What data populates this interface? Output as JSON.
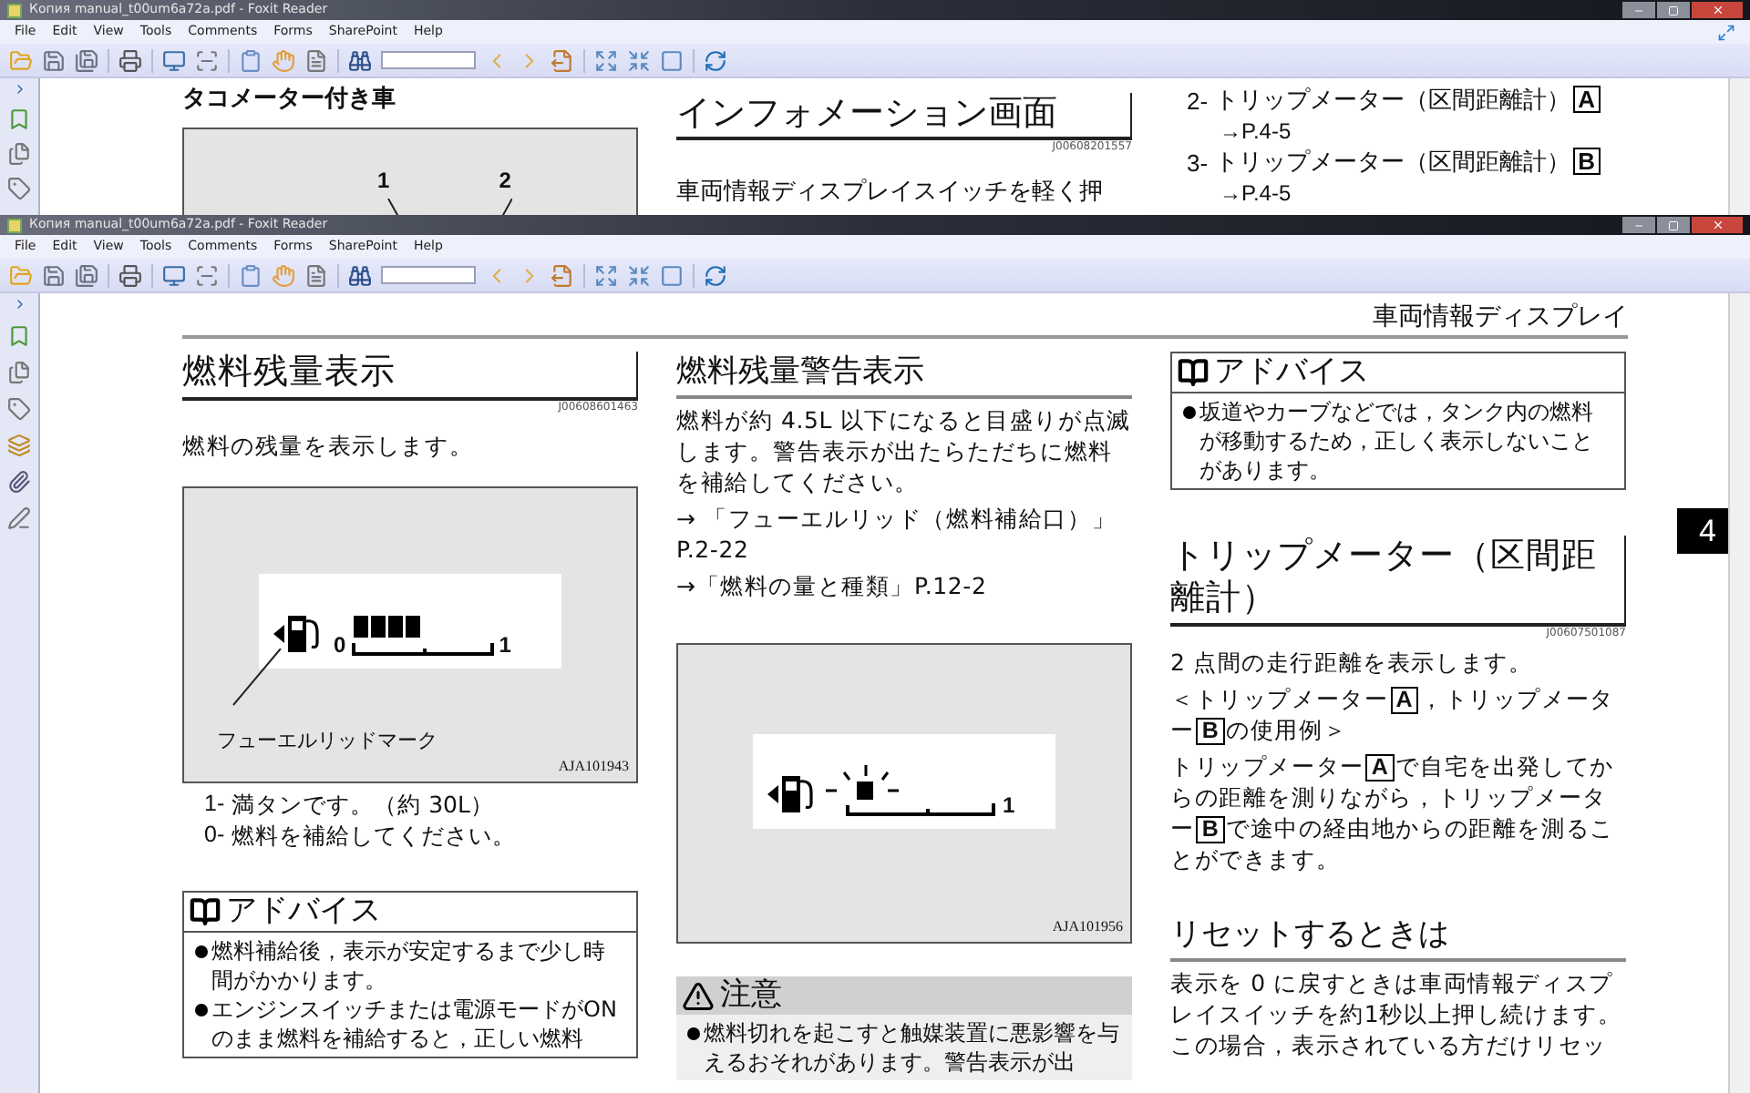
{
  "top_window": {
    "title": "Копия manual_t00um6a72a.pdf - Foxit Reader",
    "menu": [
      "File",
      "Edit",
      "View",
      "Tools",
      "Comments",
      "Forms",
      "SharePoint",
      "Help"
    ],
    "page": {
      "left_heading": "タコメーター付き車",
      "figure_labels": [
        "1",
        "2"
      ],
      "section_title": "インフォメーション画面",
      "section_code": "J00608201557",
      "paragraph": "車両情報ディスプレイスイッチを軽く押",
      "list": [
        {
          "number": "2-",
          "text": "トリップメーター（区間距離計）",
          "key": "A",
          "ref": "→P.4-5"
        },
        {
          "number": "3-",
          "text": "トリップメーター（区間距離計）",
          "key": "B",
          "ref": "→P.4-5"
        }
      ]
    }
  },
  "bottom_window": {
    "title": "Копия manual_t00um6a72a.pdf - Foxit Reader",
    "menu": [
      "File",
      "Edit",
      "View",
      "Tools",
      "Comments",
      "Forms",
      "SharePoint",
      "Help"
    ],
    "page": {
      "running_header": "車両情報ディスプレイ",
      "chapter_tab": "4",
      "columns": [
        {
          "blocks": [
            {
              "kind": "title",
              "text": "燃料残量表示",
              "code": "J00608601463"
            },
            {
              "kind": "paragraph",
              "segments": [
                {
                  "kind": "text",
                  "text": "燃料の残量を表示します。"
                }
              ]
            },
            {
              "kind": "gauge_figure",
              "labels": [
                "0",
                "1"
              ],
              "caption": "フューエルリッドマーク",
              "code": "AJA101943"
            },
            {
              "kind": "list",
              "items": [
                {
                  "number": "1-",
                  "text": "満タンです。（約 30L）"
                },
                {
                  "number": "0-",
                  "text": "燃料を補給してください。"
                }
              ]
            },
            {
              "kind": "advice",
              "title": "アドバイス",
              "bullets": [
                "燃料補給後，表示が安定するまで少し時間がかかります。",
                "エンジンスイッチまたは電源モードがON のまま燃料を補給すると，正しい燃料"
              ]
            }
          ]
        },
        {
          "blocks": [
            {
              "kind": "subtitle",
              "text": "燃料残量警告表示"
            },
            {
              "kind": "paragraph",
              "segments": [
                {
                  "kind": "text",
                  "text": "燃料が約 4.5L 以下になると目盛りが点滅します。警告表示が出たらただちに燃料を補給してください。"
                }
              ]
            },
            {
              "kind": "paragraph",
              "segments": [
                {
                  "kind": "text",
                  "text": "→ 「フューエルリッド（燃料補給口）」P.2-22"
                }
              ]
            },
            {
              "kind": "paragraph",
              "segments": [
                {
                  "kind": "text",
                  "text": "→「燃料の量と種類」P.12-2"
                }
              ]
            },
            {
              "kind": "warning_figure",
              "labels": [
                "1"
              ],
              "code": "AJA101956"
            },
            {
              "kind": "caution",
              "title": "注意",
              "bullets": [
                "燃料切れを起こすと触媒装置に悪影響を与えるおそれがあります。警告表示が出"
              ]
            }
          ]
        },
        {
          "blocks": [
            {
              "kind": "advice",
              "title": "アドバイス",
              "bullets": [
                "坂道やカーブなどでは，タンク内の燃料が移動するため，正しく表示しないことがあります。"
              ]
            },
            {
              "kind": "title",
              "text": "トリップメーター（区間距離計）",
              "code": "J00607501087"
            },
            {
              "kind": "paragraph",
              "segments": [
                {
                  "kind": "text",
                  "text": "2 点間の走行距離を表示します。"
                }
              ]
            },
            {
              "kind": "paragraph",
              "segments": [
                {
                  "kind": "text",
                  "text": "＜トリップメーター"
                },
                {
                  "kind": "key",
                  "text": "A"
                },
                {
                  "kind": "text",
                  "text": "，トリップメーター"
                },
                {
                  "kind": "key",
                  "text": "B"
                },
                {
                  "kind": "text",
                  "text": "の使用例＞"
                }
              ]
            },
            {
              "kind": "paragraph",
              "segments": [
                {
                  "kind": "text",
                  "text": "トリップメーター"
                },
                {
                  "kind": "key",
                  "text": "A"
                },
                {
                  "kind": "text",
                  "text": "で自宅を出発してからの距離を測りながら，トリップメーター"
                },
                {
                  "kind": "key",
                  "text": "B"
                },
                {
                  "kind": "text",
                  "text": "で途中の経由地からの距離を測ることができます。"
                }
              ]
            },
            {
              "kind": "subtitle",
              "text": "リセットするときは"
            },
            {
              "kind": "paragraph",
              "segments": [
                {
                  "kind": "text",
                  "text": "表示を 0 に戻すときは車両情報ディスプレイスイッチを約1秒以上押し続けます。この場合，表示されている方だけリセッ"
                }
              ]
            }
          ]
        }
      ]
    }
  }
}
